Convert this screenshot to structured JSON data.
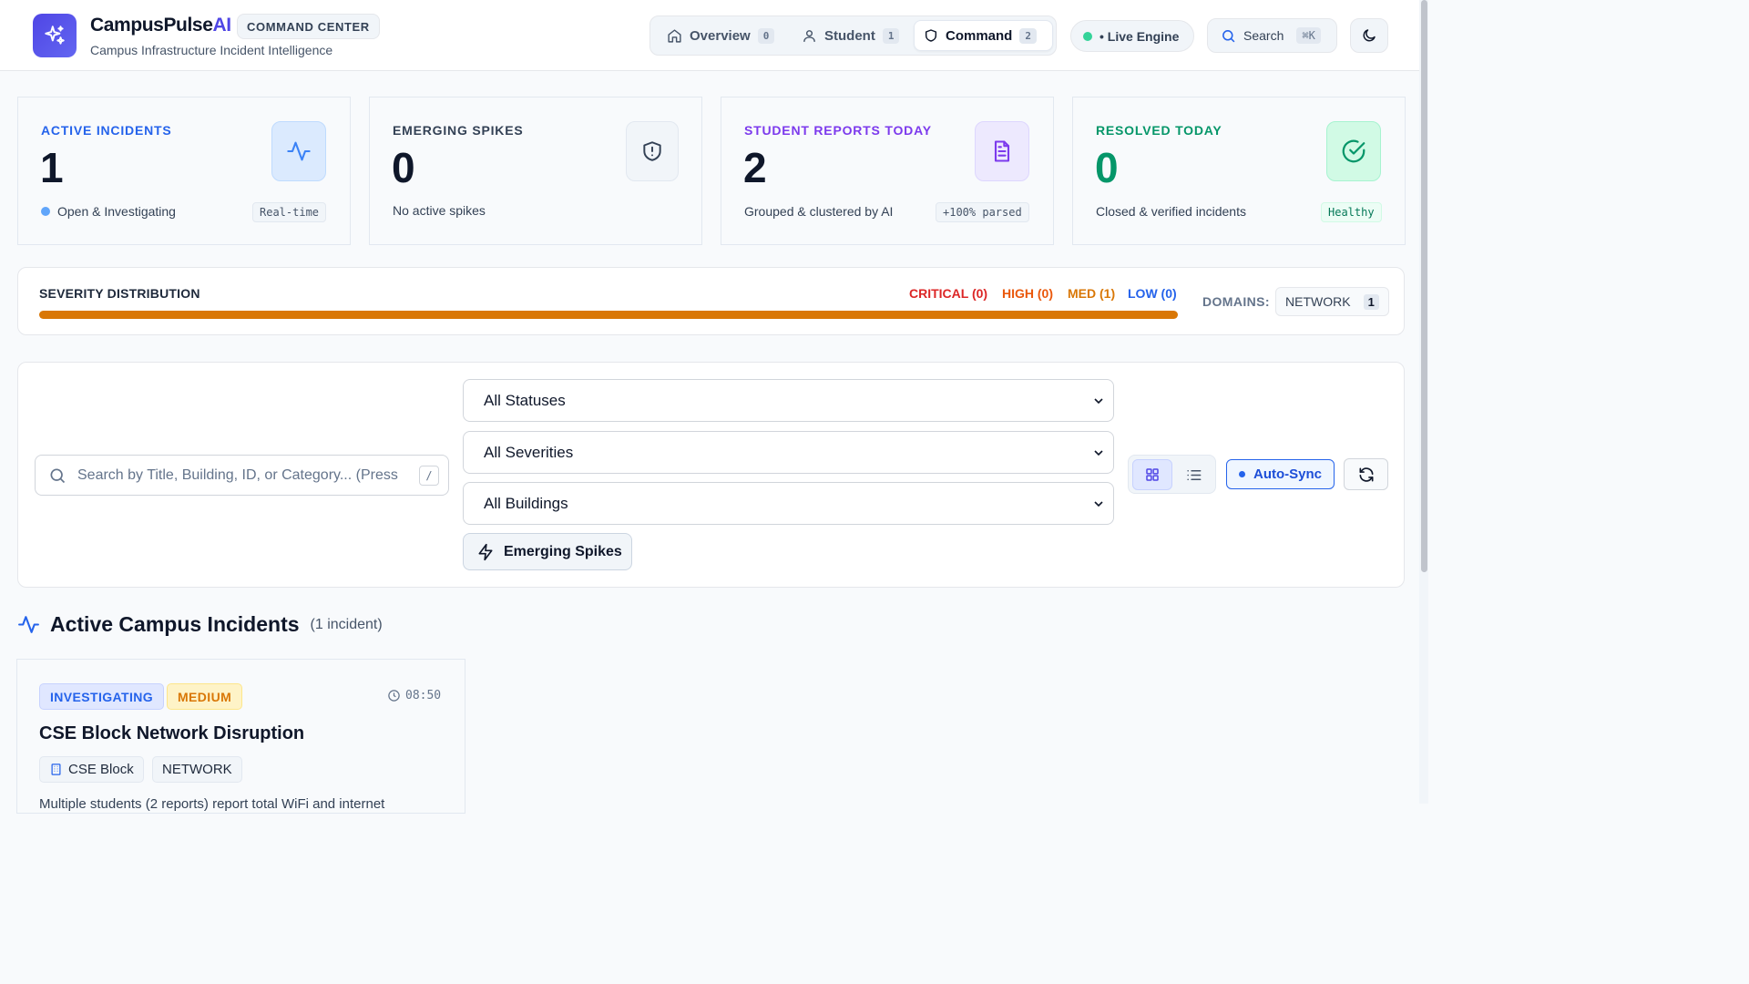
{
  "header": {
    "brand_main": "CampusPulse",
    "brand_accent": "AI",
    "badge": "COMMAND CENTER",
    "subtitle": "Campus Infrastructure Incident Intelligence",
    "logo_icon": "sparkles-icon"
  },
  "nav": {
    "items": [
      {
        "label": "Overview",
        "count": "0",
        "icon": "home-icon"
      },
      {
        "label": "Student",
        "count": "1",
        "icon": "user-icon"
      },
      {
        "label": "Command",
        "count": "2",
        "icon": "shield-icon",
        "active": true
      }
    ],
    "live_label": "• Live Engine",
    "search_label": "Search",
    "search_shortcut": "⌘K",
    "theme_icon": "moon-icon"
  },
  "stats": [
    {
      "label": "ACTIVE INCIDENTS",
      "value": "1",
      "desc": "Open & Investigating",
      "tag": "Real-time",
      "color": "#2563eb",
      "icon": "activity-icon"
    },
    {
      "label": "EMERGING SPIKES",
      "value": "0",
      "desc": "No active spikes",
      "tag": "",
      "color": "#334155",
      "icon": "shield-alert-icon"
    },
    {
      "label": "STUDENT REPORTS TODAY",
      "value": "2",
      "desc": "Grouped & clustered by AI",
      "tag": "+100% parsed",
      "color": "#7c3aed",
      "icon": "file-text-icon"
    },
    {
      "label": "RESOLVED TODAY",
      "value": "0",
      "desc": "Closed & verified incidents",
      "tag": "Healthy",
      "color": "#059669",
      "icon": "check-circle-icon"
    }
  ],
  "severity": {
    "title": "SEVERITY DISTRIBUTION",
    "legend": [
      {
        "label": "CRITICAL (0)",
        "value": 0,
        "color": "#dc2626"
      },
      {
        "label": "HIGH (0)",
        "value": 0,
        "color": "#ea580c"
      },
      {
        "label": "MED (1)",
        "value": 1,
        "color": "#d97706"
      },
      {
        "label": "LOW (0)",
        "value": 0,
        "color": "#2563eb"
      }
    ],
    "domains_label": "DOMAINS:",
    "domain": {
      "name": "NETWORK",
      "count": "1"
    }
  },
  "filters": {
    "search_placeholder": "Search by Title, Building, ID, or Category... (Press /)",
    "search_shortcut": "/",
    "status": "All Statuses",
    "severity": "All Severities",
    "building": "All Buildings",
    "spikes_label": "Emerging Spikes",
    "autosync_label": "Auto-Sync"
  },
  "section": {
    "title": "Active Campus Incidents",
    "count": "(1 incident)"
  },
  "incident": {
    "status": "INVESTIGATING",
    "severity": "MEDIUM",
    "time": "08:50",
    "title": "CSE Block Network Disruption",
    "building": "CSE Block",
    "category": "NETWORK",
    "description": "Multiple students (2 reports) report total WiFi and internet"
  }
}
